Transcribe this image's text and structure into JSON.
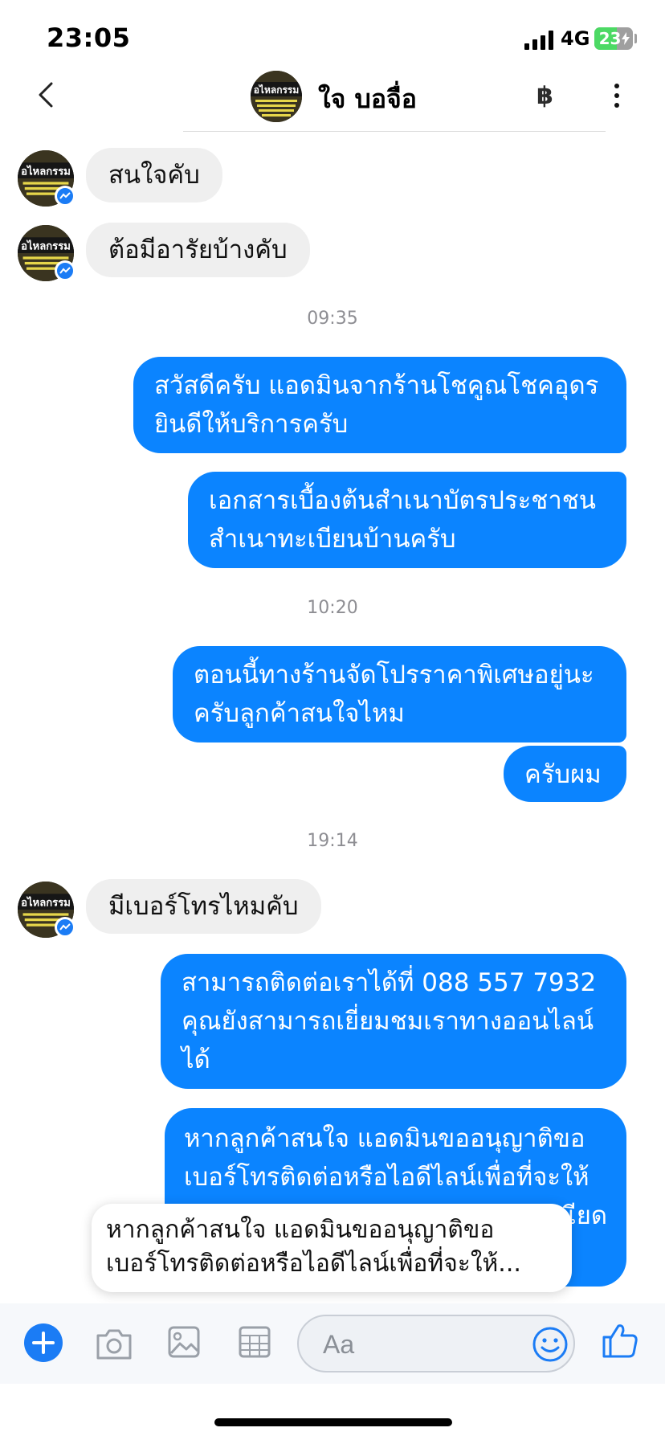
{
  "status_bar": {
    "time": "23:05",
    "network": "4G",
    "battery": "23"
  },
  "header": {
    "title": "ใจ บอจื่อ",
    "currency_symbol": "฿"
  },
  "avatar_text": "อไหลกรรม",
  "messages": {
    "in_1": "สนใจคับ",
    "in_2": "ต้อมีอารัยบ้างคับ",
    "time_1": "09:35",
    "out_1": "สวัสดีครับ แอดมินจากร้านโชคูณโชคอุดร\nยินดีให้บริการครับ",
    "out_2": "เอกสารเบื้องต้นสำเนาบัตรประชาชน\nสำเนาทะเบียนบ้านครับ",
    "time_2": "10:20",
    "out_3": "ตอนนี้ทางร้านจัดโปรราคาพิเศษอยู่นะ\nครับลูกค้าสนใจไหม",
    "out_4": "ครับผม",
    "time_3": "19:14",
    "in_3": "มีเบอร์โทรไหมคับ",
    "out_5": "สามารถติดต่อเราได้ที่ 088 557 7932\nคุณยังสามารถเยี่ยมชมเราทางออนไลน์\nได้",
    "out_6_line1": "หากลูกค้าสนใจ แอดมินขออนุญาติขอ",
    "out_6_line2": "เบอร์โทรติดต่อหรือไอดีไลน์เพื่อที่จะให้",
    "out_6_line3_tail": "เียด"
  },
  "reply_preview": "หากลูกค้าสนใจ แอดมินขออนุญาติขอ\nเบอร์โทรติดต่อหรือไอดีไลน์เพื่อที่จะให้...",
  "composer": {
    "placeholder": "Aa"
  },
  "colors": {
    "accent": "#0b84ff",
    "incoming_bg": "#efefef",
    "messenger_badge": "#1b7cf5"
  }
}
